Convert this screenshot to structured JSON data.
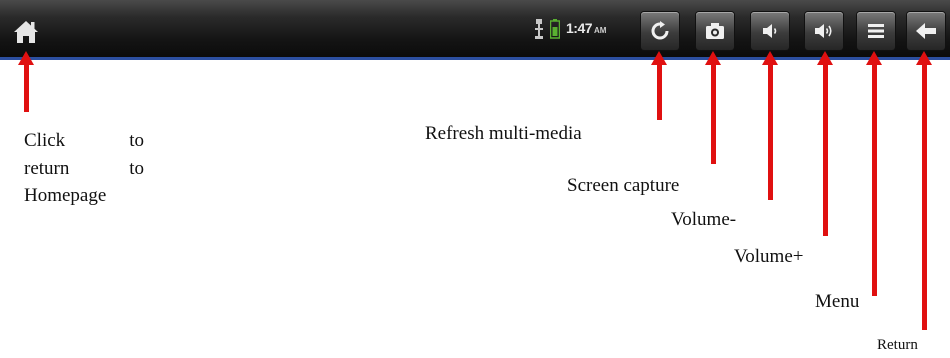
{
  "status_bar": {
    "time": "1:47",
    "ampm": "AM",
    "icons": [
      "home-icon",
      "usb-icon",
      "battery-icon",
      "refresh-icon",
      "camera-icon",
      "volume-down-icon",
      "volume-up-icon",
      "menu-icon",
      "back-arrow-icon"
    ]
  },
  "annotations": {
    "home": {
      "line1_a": "Click",
      "line1_b": "to",
      "line2_a": "return",
      "line2_b": "to",
      "line3": "Homepage"
    },
    "refresh": "Refresh multi-media",
    "screen_capture": "Screen capture",
    "volume_down": "Volume-",
    "volume_up": "Volume+",
    "menu": "Menu",
    "return": "Return"
  },
  "colors": {
    "arrow": "#e01010",
    "bar_bottom_border": "#2c4fa0"
  }
}
